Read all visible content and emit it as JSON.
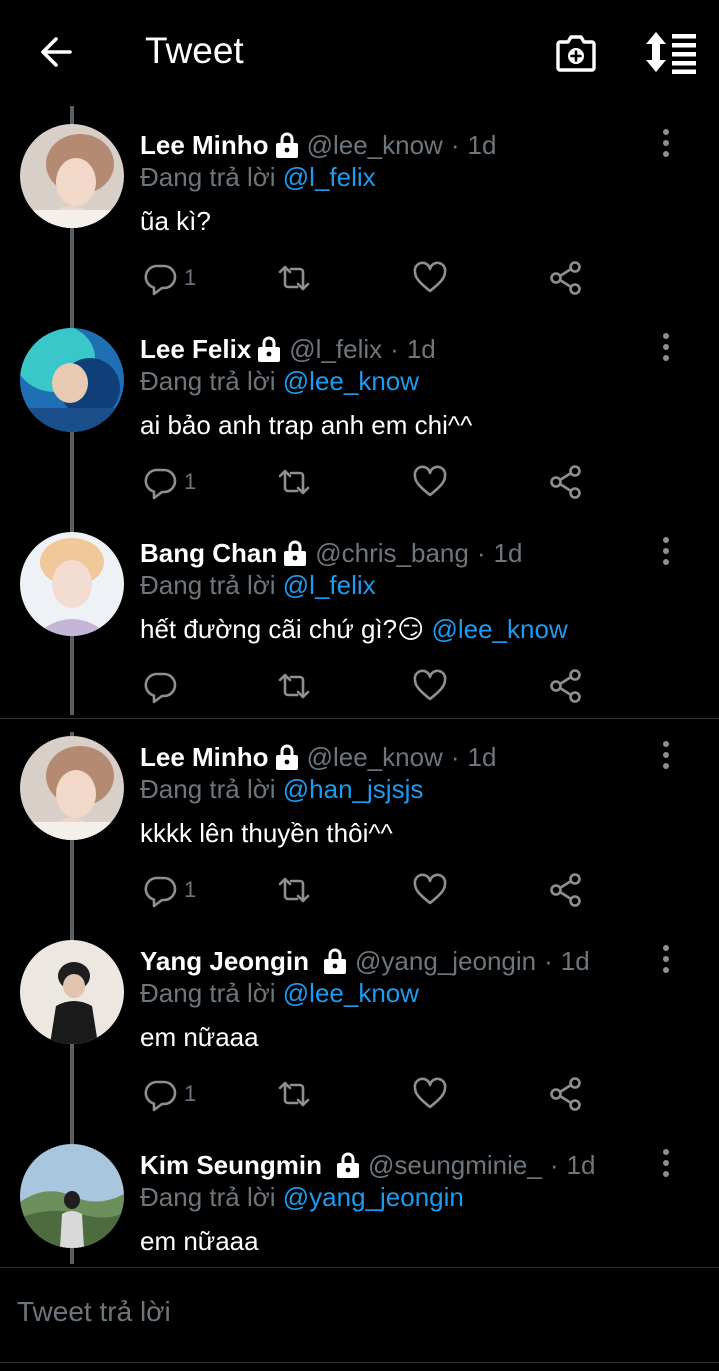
{
  "header": {
    "title": "Tweet"
  },
  "reply_prefix": "Đang trả lời ",
  "tweets": [
    {
      "name": "Lee Minho",
      "handle": "@lee_know",
      "sep": "·",
      "time": "1d",
      "reply_to": "@l_felix",
      "text": "ũa kì?",
      "mention": "",
      "reply_count": "1"
    },
    {
      "name": "Lee Felix",
      "handle": "@l_felix",
      "sep": "·",
      "time": "1d",
      "reply_to": "@lee_know",
      "text": "ai bảo anh trap anh em chi^^",
      "mention": "",
      "reply_count": "1"
    },
    {
      "name": "Bang Chan",
      "handle": "@chris_bang",
      "sep": "·",
      "time": "1d",
      "reply_to": "@l_felix",
      "text": "hết đường cãi chứ gì?😏",
      "mention": "@lee_know",
      "reply_count": ""
    },
    {
      "name": "Lee Minho",
      "handle": "@lee_know",
      "sep": "·",
      "time": "1d",
      "reply_to": "@han_jsjsjs",
      "text": "kkkk lên thuyền thôi^^",
      "mention": "",
      "reply_count": "1"
    },
    {
      "name": "Yang Jeongin",
      "handle": "@yang_jeongin",
      "sep": "·",
      "time": "1d",
      "reply_to": "@lee_know",
      "text": "em nữaaa",
      "mention": "",
      "reply_count": "1"
    },
    {
      "name": "Kim Seungmin",
      "handle": "@seungminie_",
      "sep": "·",
      "time": "1d",
      "reply_to": "@yang_jeongin",
      "text": "em nữaaa",
      "mention": "",
      "reply_count": ""
    }
  ],
  "reply_bar": {
    "placeholder": "Tweet trả lời"
  },
  "colors": {
    "background": "#000000",
    "accent": "#1d9bf0",
    "muted": "#6e767d",
    "divider": "#2f3336"
  },
  "icons": [
    "back-arrow-icon",
    "camera-add-icon",
    "sort-icon",
    "lock-icon",
    "more-vertical-icon",
    "reply-icon",
    "retweet-icon",
    "like-icon",
    "share-icon"
  ]
}
